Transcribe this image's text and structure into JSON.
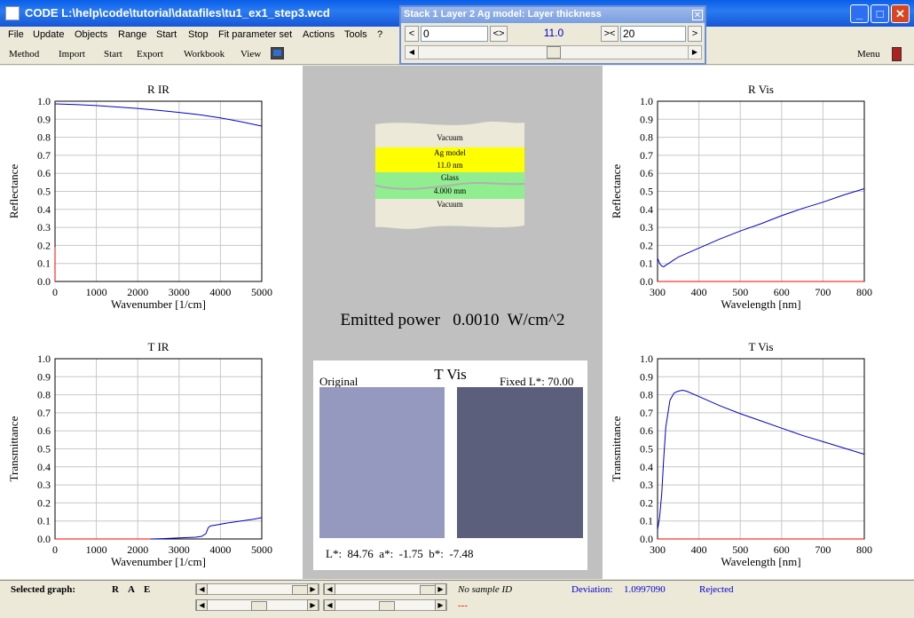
{
  "window": {
    "title": "CODE L:\\help\\code\\tutorial\\datafiles\\tu1_ex1_step3.wcd",
    "minimize": "_",
    "maximize": "□",
    "close": "✕"
  },
  "menu": [
    "File",
    "Update",
    "Objects",
    "Range",
    "Start",
    "Stop",
    "Fit parameter set",
    "Actions",
    "Tools",
    "?"
  ],
  "toolbar": {
    "items": [
      "Method",
      "Import",
      "Start",
      "Export",
      "Workbook",
      "View"
    ],
    "menu_label": "Menu"
  },
  "slider_window": {
    "title": "Stack 1 Layer  2 Ag model: Layer thickness",
    "min_value": "0",
    "max_value": "20",
    "current": "11.0",
    "btn_left": "<",
    "btn_shrink": "<>",
    "btn_expand": "><",
    "btn_right": ">",
    "position": 0.5
  },
  "layer_stack": [
    {
      "label": "Vacuum",
      "color": "#ece9d8"
    },
    {
      "label": "Ag model",
      "color": "#ffff00"
    },
    {
      "label": "11.0 nm",
      "color": "#ffff00"
    },
    {
      "label": "Glass",
      "color": "#90ee90"
    },
    {
      "label": "4.000 mm",
      "color": "#90ee90"
    },
    {
      "label": "Vacuum",
      "color": "#ece9d8"
    }
  ],
  "emitted_power": {
    "label": "Emitted power",
    "value": "0.0010",
    "unit": "W/cm^2"
  },
  "color_panel": {
    "title": "T Vis",
    "original_label": "Original",
    "fixed_label": "Fixed L*:  70.00",
    "original_color": "#9699bf",
    "fixed_color": "#5c5f7c",
    "lab_text": "L*:  84.76  a*:  -1.75  b*:  -7.48"
  },
  "status": {
    "selected_graph_label": "Selected graph:",
    "graph_buttons": [
      "R",
      "A",
      "E"
    ],
    "sample_id": "No sample ID",
    "deviation_label": "Deviation:",
    "deviation_value": "1.0997090",
    "rejected": "Rejected",
    "dash": "---"
  },
  "colors": {
    "data_line": "#0000cc",
    "red_line": "#ff0000",
    "center_bg": "#c0c0c0",
    "accent": "#0000cc"
  },
  "chart_data": [
    {
      "id": "r-ir",
      "type": "line",
      "title": "R IR",
      "xlabel": "Wavenumber [1/cm]",
      "ylabel": "Reflectance",
      "xlim": [
        0,
        5000
      ],
      "ylim": [
        0,
        1.0
      ],
      "xticks": [
        0,
        1000,
        2000,
        3000,
        4000,
        5000
      ],
      "yticks": [
        0,
        0.1,
        0.2,
        0.3,
        0.4,
        0.5,
        0.6,
        0.7,
        0.8,
        0.9,
        1.0
      ],
      "ytick_labels": [
        "0.0",
        "0.1",
        "0.2",
        "0.3",
        "0.4",
        "0.5",
        "0.6",
        "0.7",
        "0.8",
        "0.9",
        "1.0"
      ],
      "series": [
        {
          "color": "#0000cc",
          "x": [
            0,
            500,
            1000,
            1500,
            2000,
            2500,
            3000,
            3500,
            4000,
            4500,
            5000
          ],
          "y": [
            0.985,
            0.982,
            0.976,
            0.968,
            0.96,
            0.95,
            0.938,
            0.925,
            0.908,
            0.886,
            0.862
          ]
        },
        {
          "color": "#ff0000",
          "x": [
            0,
            0,
            0
          ],
          "y": [
            0.0,
            0.1,
            0.19
          ]
        }
      ]
    },
    {
      "id": "t-ir",
      "type": "line",
      "title": "T IR",
      "xlabel": "Wavenumber [1/cm]",
      "ylabel": "Transmittance",
      "xlim": [
        0,
        5000
      ],
      "ylim": [
        0,
        1.0
      ],
      "xticks": [
        0,
        1000,
        2000,
        3000,
        4000,
        5000
      ],
      "yticks": [
        0,
        0.1,
        0.2,
        0.3,
        0.4,
        0.5,
        0.6,
        0.7,
        0.8,
        0.9,
        1.0
      ],
      "ytick_labels": [
        "0.0",
        "0.1",
        "0.2",
        "0.3",
        "0.4",
        "0.5",
        "0.6",
        "0.7",
        "0.8",
        "0.9",
        "1.0"
      ],
      "series": [
        {
          "color": "#0000cc",
          "x": [
            2300,
            2600,
            2900,
            3200,
            3400,
            3550,
            3650,
            3700,
            3750,
            3900,
            4200,
            4500,
            4800,
            5000
          ],
          "y": [
            0.0,
            0.002,
            0.005,
            0.008,
            0.01,
            0.015,
            0.03,
            0.06,
            0.072,
            0.078,
            0.09,
            0.1,
            0.11,
            0.118
          ]
        },
        {
          "color": "#ff0000",
          "x": [
            0,
            2300
          ],
          "y": [
            0.0,
            0.0
          ]
        }
      ]
    },
    {
      "id": "r-vis",
      "type": "line",
      "title": "R Vis",
      "xlabel": "Wavelength [nm]",
      "ylabel": "Reflectance",
      "xlim": [
        300,
        800
      ],
      "ylim": [
        0,
        1.0
      ],
      "xticks": [
        300,
        400,
        500,
        600,
        700,
        800
      ],
      "yticks": [
        0,
        0.1,
        0.2,
        0.3,
        0.4,
        0.5,
        0.6,
        0.7,
        0.8,
        0.9,
        1.0
      ],
      "ytick_labels": [
        "0.0",
        "0.1",
        "0.2",
        "0.3",
        "0.4",
        "0.5",
        "0.6",
        "0.7",
        "0.8",
        "0.9",
        "1.0"
      ],
      "series": [
        {
          "color": "#0000cc",
          "x": [
            300,
            305,
            310,
            315,
            320,
            330,
            340,
            350,
            400,
            450,
            500,
            550,
            600,
            650,
            700,
            750,
            800
          ],
          "y": [
            0.13,
            0.1,
            0.085,
            0.082,
            0.09,
            0.105,
            0.12,
            0.135,
            0.185,
            0.235,
            0.28,
            0.32,
            0.365,
            0.405,
            0.44,
            0.48,
            0.515
          ]
        },
        {
          "color": "#ff0000",
          "x": [
            300,
            800
          ],
          "y": [
            0.0,
            0.0
          ]
        }
      ]
    },
    {
      "id": "t-vis",
      "type": "line",
      "title": "T Vis",
      "xlabel": "Wavelength [nm]",
      "ylabel": "Transmittance",
      "xlim": [
        300,
        800
      ],
      "ylim": [
        0,
        1.0
      ],
      "xticks": [
        300,
        400,
        500,
        600,
        700,
        800
      ],
      "yticks": [
        0,
        0.1,
        0.2,
        0.3,
        0.4,
        0.5,
        0.6,
        0.7,
        0.8,
        0.9,
        1.0
      ],
      "ytick_labels": [
        "0.0",
        "0.1",
        "0.2",
        "0.3",
        "0.4",
        "0.5",
        "0.6",
        "0.7",
        "0.8",
        "0.9",
        "1.0"
      ],
      "series": [
        {
          "color": "#0000cc",
          "x": [
            300,
            305,
            310,
            315,
            320,
            330,
            340,
            350,
            360,
            370,
            400,
            450,
            500,
            550,
            600,
            650,
            700,
            750,
            800
          ],
          "y": [
            0.05,
            0.12,
            0.25,
            0.45,
            0.62,
            0.77,
            0.81,
            0.82,
            0.825,
            0.82,
            0.79,
            0.74,
            0.695,
            0.655,
            0.615,
            0.575,
            0.54,
            0.505,
            0.47
          ]
        },
        {
          "color": "#ff0000",
          "x": [
            300,
            800
          ],
          "y": [
            0.0,
            0.0
          ]
        }
      ]
    }
  ]
}
